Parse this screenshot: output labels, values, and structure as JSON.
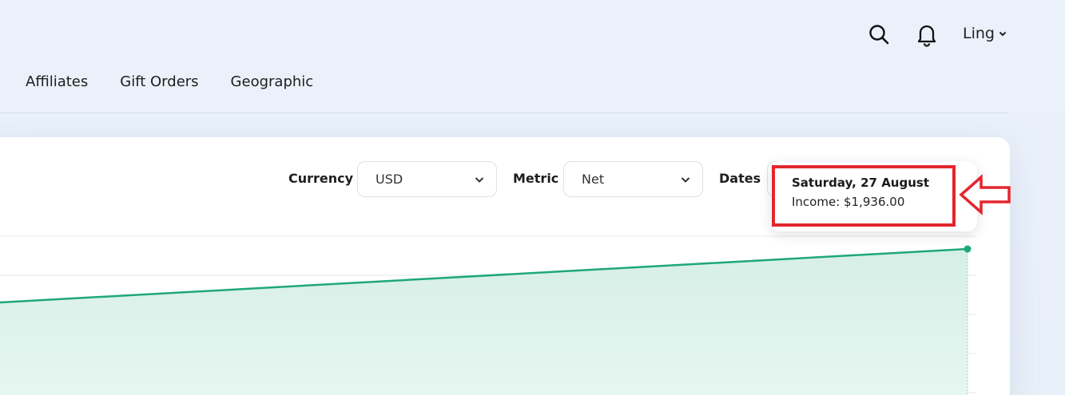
{
  "header": {
    "user_name": "Ling",
    "icons": [
      "search-icon",
      "bell-icon",
      "chevron-down-icon"
    ]
  },
  "nav": {
    "tabs": [
      {
        "label": "Affiliates"
      },
      {
        "label": "Gift Orders"
      },
      {
        "label": "Geographic"
      }
    ]
  },
  "filters": {
    "currency_label": "Currency",
    "currency_value": "USD",
    "metric_label": "Metric",
    "metric_value": "Net",
    "dates_label": "Dates"
  },
  "tooltip": {
    "title": "Saturday, 27 August",
    "value_text": "Income: $1,936.00"
  },
  "chart_data": {
    "type": "area",
    "series": [
      {
        "values": [
          1936.0
        ]
      }
    ],
    "x": [
      "Saturday, 27 August"
    ],
    "grid": true,
    "color": "#1fa77a",
    "fill_color": "#dcf1ea"
  },
  "annotation": {
    "color": "#e3262e"
  }
}
